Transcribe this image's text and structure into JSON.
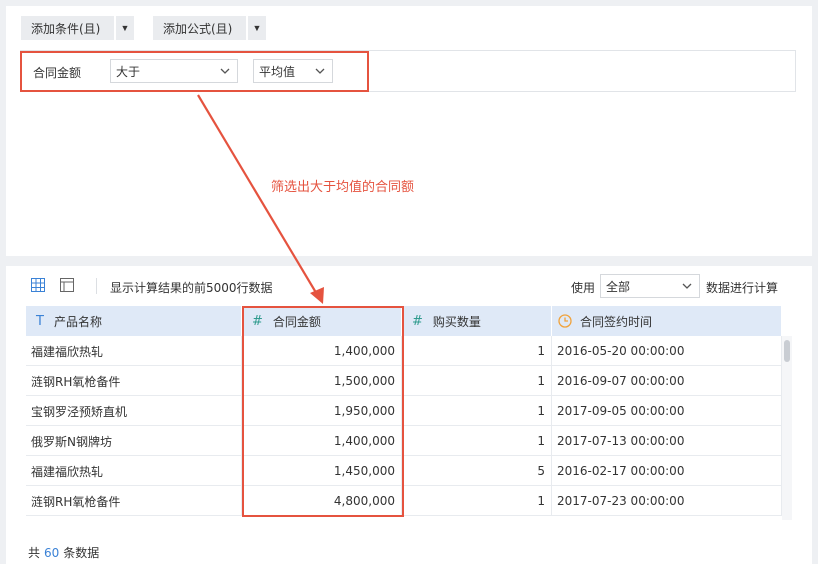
{
  "filter_panel": {
    "add_condition_label": "添加条件(且)",
    "add_formula_label": "添加公式(且)",
    "condition": {
      "field": "合同金额",
      "operator": "大于",
      "value": "平均值"
    }
  },
  "annotation": {
    "text": "筛选出大于均值的合同额",
    "color": "#e5533f"
  },
  "data_panel": {
    "preview_text": "显示计算结果的前5000行数据",
    "use_label": "使用",
    "use_value": "全部",
    "use_suffix": "数据进行计算",
    "columns": [
      {
        "type_icon": "T",
        "label": "产品名称"
      },
      {
        "type_icon": "#",
        "label": "合同金额"
      },
      {
        "type_icon": "#",
        "label": "购买数量"
      },
      {
        "type_icon": "clock-icon",
        "label": "合同签约时间"
      }
    ],
    "rows": [
      [
        "福建福欣热轧",
        "1,400,000",
        "1",
        "2016-05-20 00:00:00"
      ],
      [
        "涟钢RH氧枪备件",
        "1,500,000",
        "1",
        "2016-09-07 00:00:00"
      ],
      [
        "宝钢罗泾预矫直机",
        "1,950,000",
        "1",
        "2017-09-05 00:00:00"
      ],
      [
        "俄罗斯N钢牌坊",
        "1,400,000",
        "1",
        "2017-07-13 00:00:00"
      ],
      [
        "福建福欣热轧",
        "1,450,000",
        "5",
        "2016-02-17 00:00:00"
      ],
      [
        "涟钢RH氧枪备件",
        "4,800,000",
        "1",
        "2017-07-23 00:00:00"
      ]
    ],
    "footer": {
      "prefix": "共",
      "count": "60",
      "suffix": "条数据"
    }
  },
  "colors": {
    "accent": "#3b82d6",
    "highlight": "#e5533f",
    "header_bg": "#dfe9f7"
  }
}
